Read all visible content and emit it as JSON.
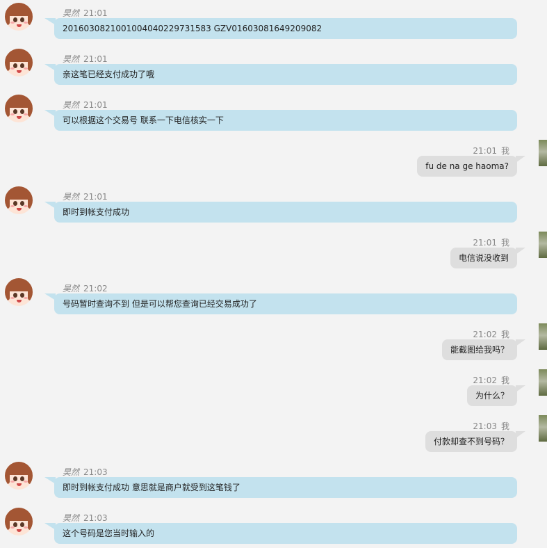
{
  "contact_name": "昊然",
  "self_label": "我",
  "messages": [
    {
      "side": "left",
      "time": "21:01",
      "text": "2016030821001004040229731583 GZV01603081649209082"
    },
    {
      "side": "left",
      "time": "21:01",
      "text": "亲这笔已经支付成功了哦"
    },
    {
      "side": "left",
      "time": "21:01",
      "text": "可以根据这个交易号 联系一下电信核实一下"
    },
    {
      "side": "right",
      "time": "21:01",
      "text": "fu de na ge haoma?"
    },
    {
      "side": "left",
      "time": "21:01",
      "text": "即时到帐支付成功"
    },
    {
      "side": "right",
      "time": "21:01",
      "text": "电信说没收到"
    },
    {
      "side": "left",
      "time": "21:02",
      "text": "号码暂时查询不到 但是可以帮您查询已经交易成功了"
    },
    {
      "side": "right",
      "time": "21:02",
      "text": "能截图给我吗？"
    },
    {
      "side": "right",
      "time": "21:02",
      "text": "为什么？"
    },
    {
      "side": "right",
      "time": "21:03",
      "text": "付款却查不到号码？"
    },
    {
      "side": "left",
      "time": "21:03",
      "text": "即时到帐支付成功 意思就是商户就受到这笔钱了"
    },
    {
      "side": "left",
      "time": "21:03",
      "text": "这个号码是您当时输入的"
    }
  ]
}
